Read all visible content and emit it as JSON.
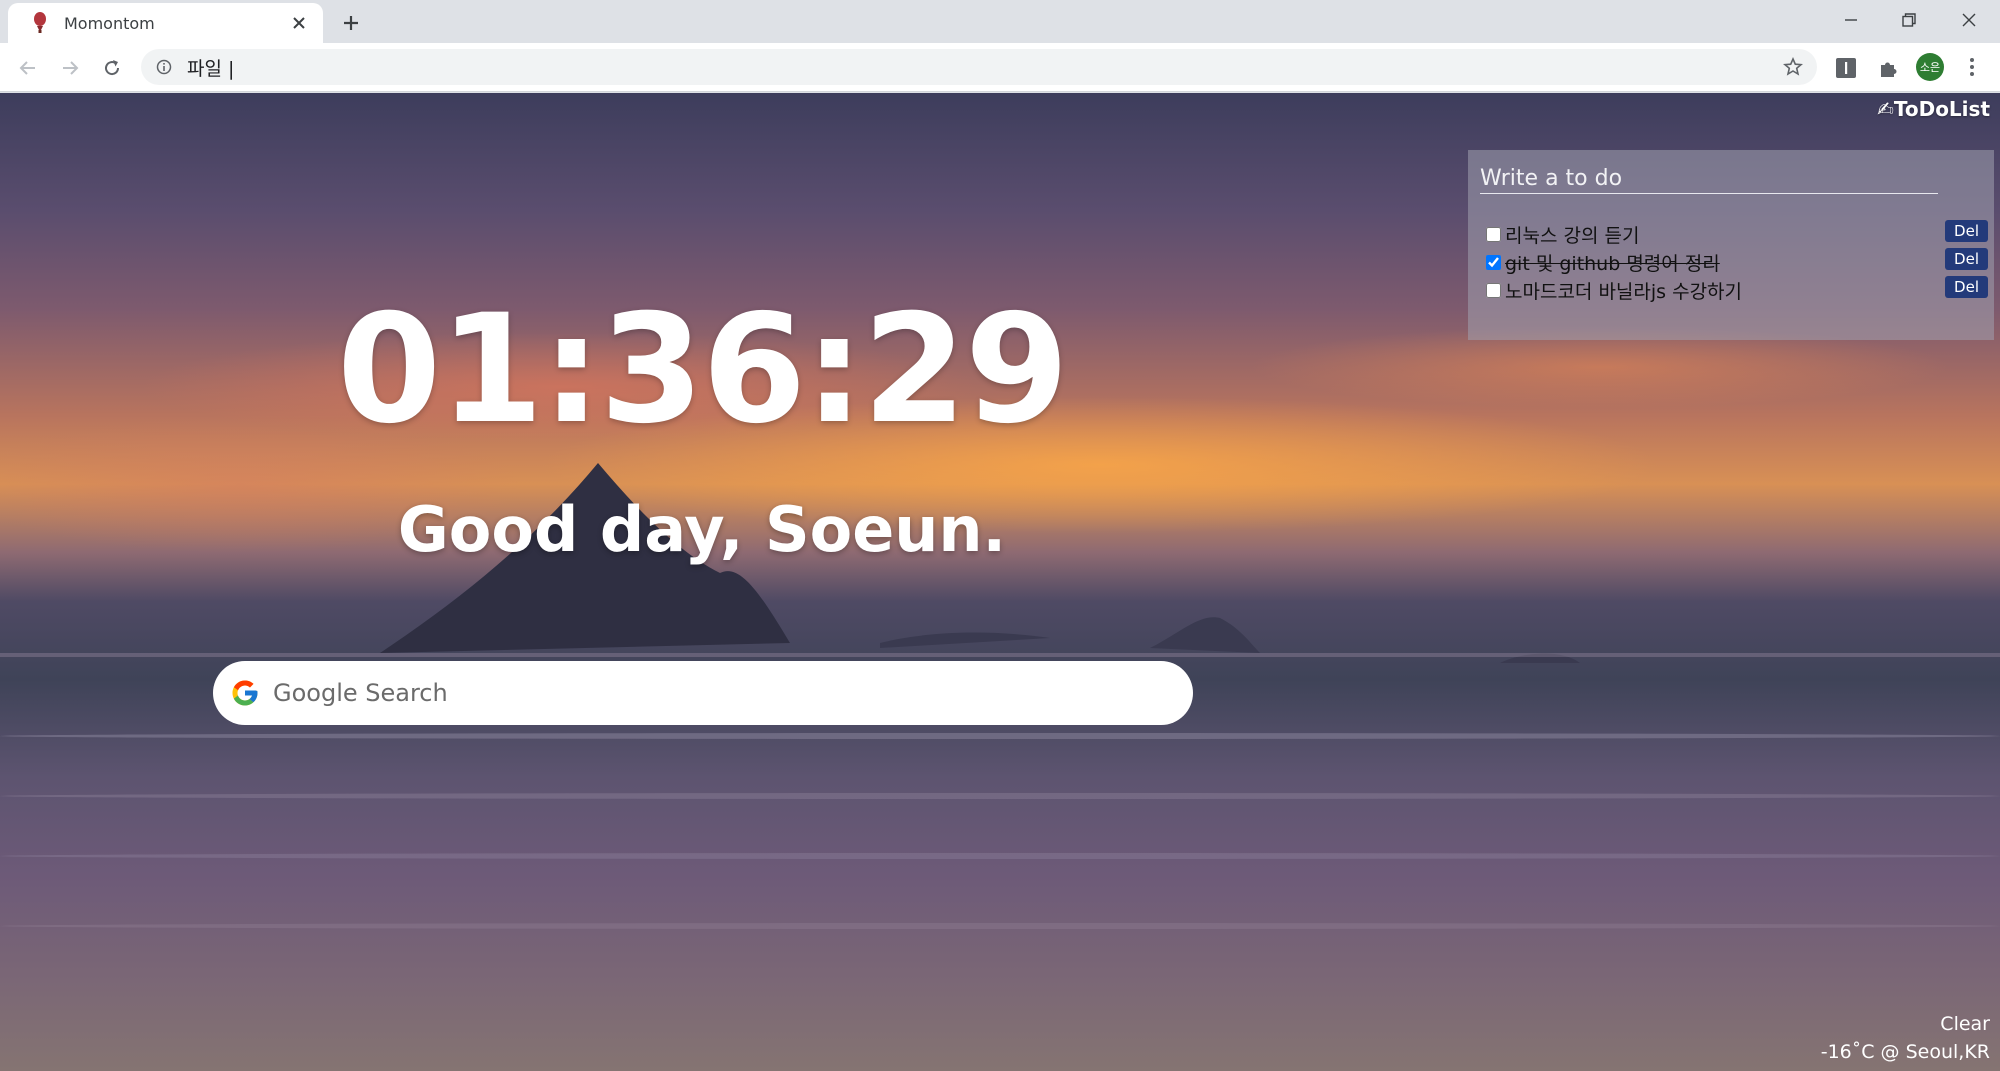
{
  "browser": {
    "tab_title": "Momontom",
    "address": "파일 |"
  },
  "page": {
    "todo_toggle": "✍ToDoList",
    "todo_placeholder": "Write a to do",
    "todos": [
      {
        "text": "리눅스 강의 듣기",
        "done": false,
        "del_label": "Del"
      },
      {
        "text": "git 및 github 명령어 정리",
        "done": true,
        "del_label": "Del"
      },
      {
        "text": "노마드코더 바닐라js 수강하기",
        "done": false,
        "del_label": "Del"
      }
    ],
    "clock": "01:36:29",
    "greeting": "Good day, Soeun.",
    "search_placeholder": "Google Search",
    "weather": {
      "condition": "Clear",
      "temp_location": "-16˚C @ Seoul,KR"
    }
  },
  "profile": {
    "avatar_initials": "소은"
  },
  "colors": {
    "accent_del": "#233a7a",
    "avatar_bg": "#2e7d32"
  }
}
